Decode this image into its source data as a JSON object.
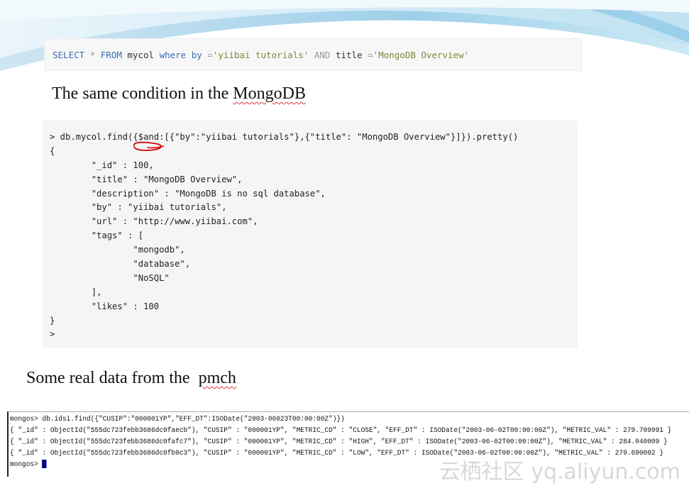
{
  "sql": {
    "select": "SELECT",
    "star": "*",
    "from": "FROM",
    "table": "mycol",
    "where": "where",
    "by_field": "by",
    "eq1": "=",
    "val1": "'yiibai tutorials'",
    "and": "AND",
    "title_field": "title",
    "eq2": "=",
    "val2": "'MongoDB Overview'"
  },
  "heading1": {
    "prefix": "The same condition in the ",
    "underlined": "MongoDB"
  },
  "mongo_shell": {
    "lines": [
      "> db.mycol.find({$and:[{\"by\":\"yiibai tutorials\"},{\"title\": \"MongoDB Overview\"}]}).pretty()",
      "{",
      "        \"_id\" : 100,",
      "        \"title\" : \"MongoDB Overview\",",
      "        \"description\" : \"MongoDB is no sql database\",",
      "        \"by\" : \"yiibai tutorials\",",
      "        \"url\" : \"http://www.yiibai.com\",",
      "        \"tags\" : [",
      "                \"mongodb\",",
      "                \"database\",",
      "                \"NoSQL\"",
      "        ],",
      "        \"likes\" : 100",
      "}",
      ">"
    ]
  },
  "heading2": {
    "prefix": "Some real data from the  ",
    "underlined": "pmch"
  },
  "terminal": {
    "lines": [
      "mongos> db.idsi.find({\"CUSIP\":\"000001YP\",\"EFF_DT\":ISODate(\"2003-06023T00:00:00Z\")})",
      "{ \"_id\" : ObjectId(\"555dc723febb3686dc0faecb\"), \"CUSIP\" : \"000001YP\", \"METRIC_CD\" : \"CLOSE\", \"EFF_DT\" : ISODate(\"2003-06-02T00:00:00Z\"), \"METRIC_VAL\" : 279.709991 }",
      "{ \"_id\" : ObjectId(\"555dc723febb3686dc0fafc7\"), \"CUSIP\" : \"000001YP\", \"METRIC_CD\" : \"HIGH\", \"EFF_DT\" : ISODate(\"2003-06-02T00:00:00Z\"), \"METRIC_VAL\" : 284.040009 }",
      "{ \"_id\" : ObjectId(\"555dc723febb3686dc0fb0c3\"), \"CUSIP\" : \"000001YP\", \"METRIC_CD\" : \"LOW\", \"EFF_DT\" : ISODate(\"2003-06-02T00:00:00Z\"), \"METRIC_VAL\" : 279.690002 }"
    ],
    "prompt": "mongos>"
  },
  "watermark": "云栖社区 yq.aliyun.com",
  "colors": {
    "keyword": "#3b6fb6",
    "string": "#7a8a3a",
    "annotation": "#d40000",
    "cursor": "#000080"
  }
}
